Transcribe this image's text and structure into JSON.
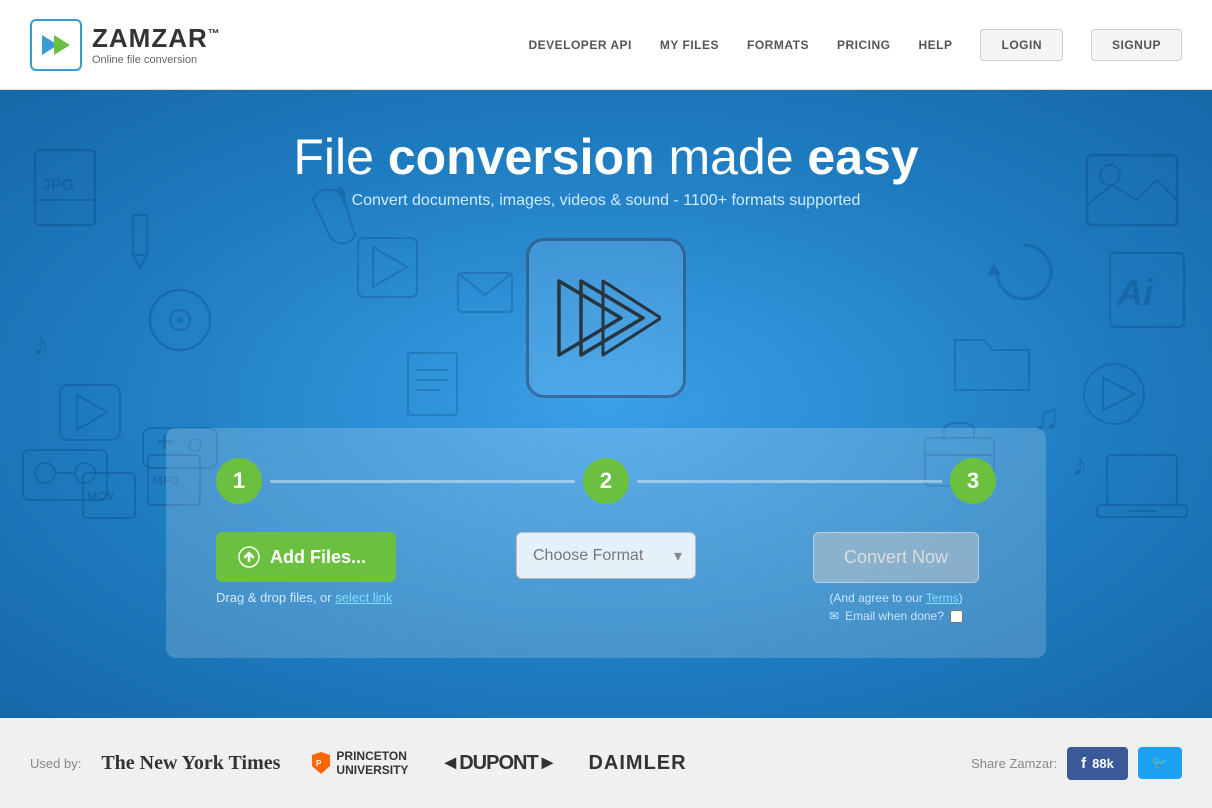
{
  "header": {
    "logo_name": "ZAMZAR",
    "logo_tm": "™",
    "logo_subtitle": "Online file conversion",
    "nav": {
      "developer_api": "DEVELOPER API",
      "my_files": "MY FILES",
      "formats": "FORMATS",
      "pricing": "PRICING",
      "help": "HELP",
      "login": "LOGIN",
      "signup": "SIGNUP"
    }
  },
  "hero": {
    "title_start": "File ",
    "title_bold1": "conversion",
    "title_middle": " made ",
    "title_bold2": "easy",
    "subtitle": "Convert documents, images, videos & sound - 1100+ formats supported"
  },
  "steps": {
    "step1": {
      "number": "1",
      "button_label": "Add Files...",
      "drag_text": "Drag & drop files, or",
      "select_link": "select link"
    },
    "step2": {
      "number": "2",
      "dropdown_placeholder": "Choose Format",
      "dropdown_arrow": "▾"
    },
    "step3": {
      "number": "3",
      "button_label": "Convert Now",
      "terms_prefix": "(And agree to our",
      "terms_link": "Terms",
      "terms_suffix": ")",
      "email_label": "Email when done?",
      "mail_icon": "✉"
    }
  },
  "footer": {
    "used_by_label": "Used by:",
    "brands": [
      {
        "name": "The New York Times",
        "style": "nyt"
      },
      {
        "name": "PRINCETON\nUNIVERSITY",
        "style": "princeton"
      },
      {
        "name": "◄DUPONT►",
        "style": "dupont"
      },
      {
        "name": "DAIMLER",
        "style": "daimler"
      }
    ],
    "share_label": "Share Zamzar:",
    "facebook_label": "f",
    "facebook_count": "88k",
    "twitter_icon": "🐦"
  }
}
